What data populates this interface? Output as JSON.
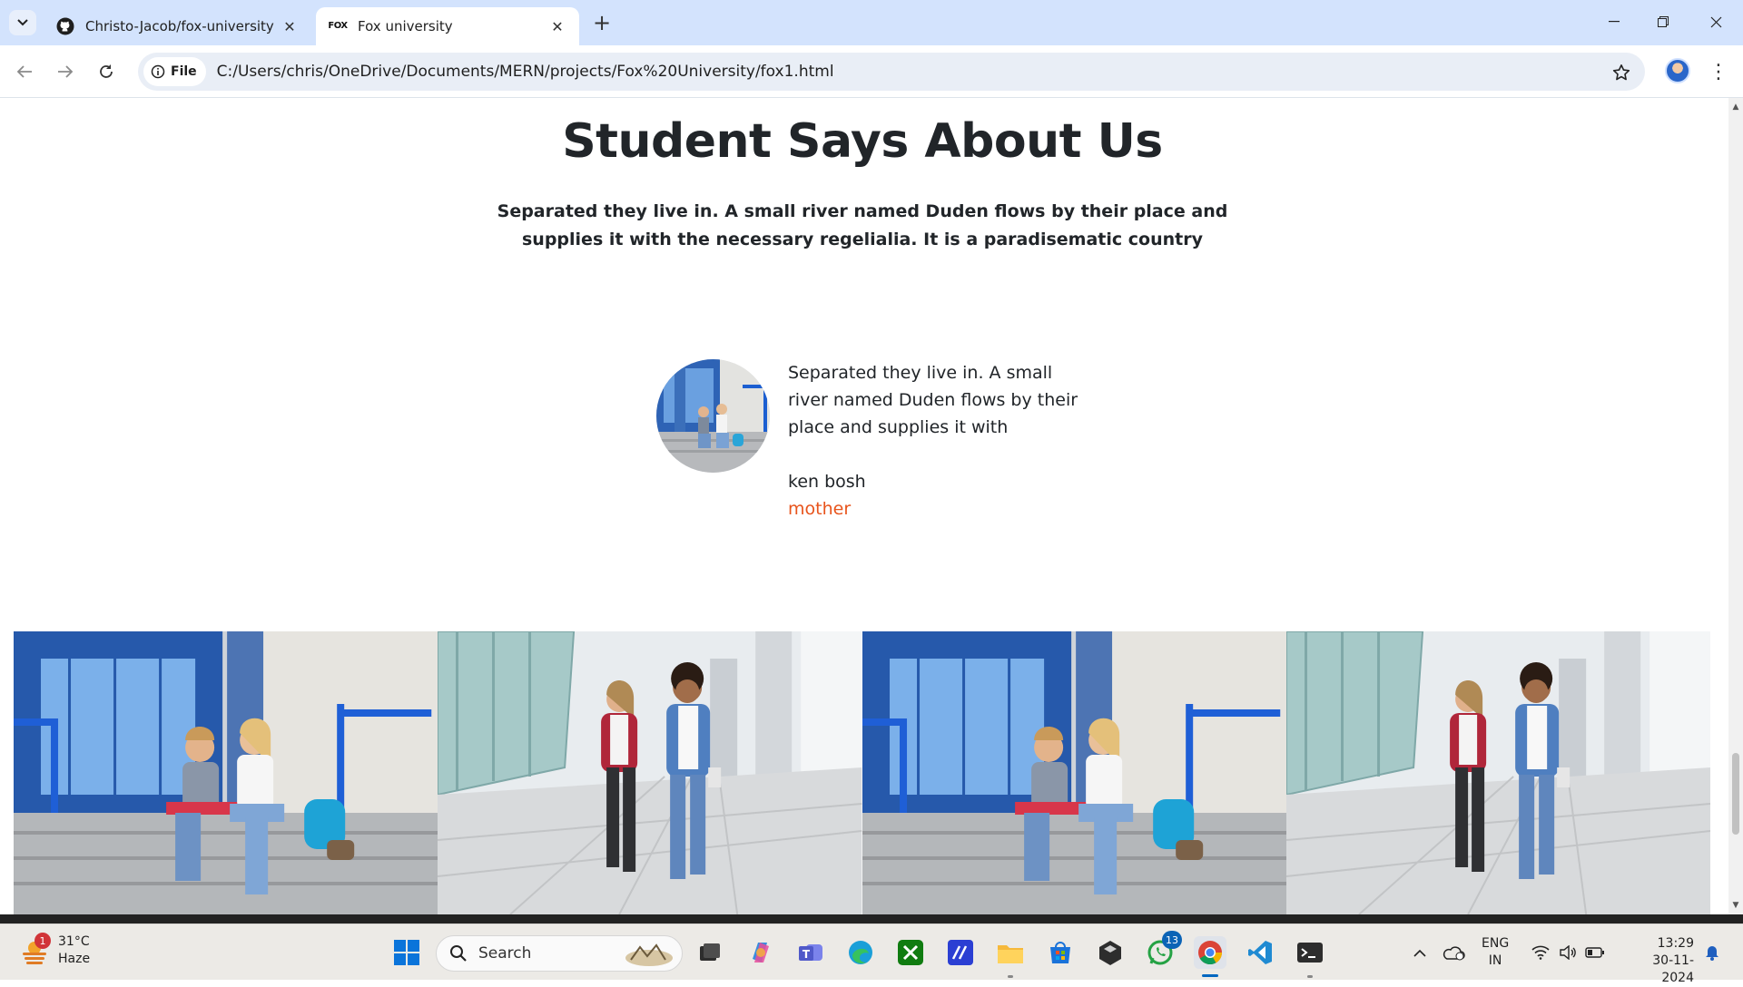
{
  "browser": {
    "tabs": [
      {
        "title": "Christo-Jacob/fox-university",
        "active": false,
        "favicon": "github-icon"
      },
      {
        "title": "Fox university",
        "active": true,
        "favicon": "fox-logo-icon"
      }
    ],
    "favicon_text": "FOX",
    "address": {
      "chip_label": "File",
      "url": "C:/Users/chris/OneDrive/Documents/MERN/projects/Fox%20University/fox1.html"
    }
  },
  "page": {
    "heading": "Student Says About Us",
    "subheading": "Separated they live in. A small river named Duden flows by their place and supplies it with the necessary regelialia. It is a paradisematic country",
    "testimonial": {
      "text": "Separated they live in. A small river named Duden flows by their place and supplies it with",
      "name": "ken bosh",
      "role": "mother",
      "role_color": "#e8541c"
    },
    "gallery": [
      "students-sitting-on-steps",
      "students-walking",
      "students-sitting-on-steps",
      "students-walking"
    ]
  },
  "taskbar": {
    "weather": {
      "temp": "31°C",
      "condition": "Haze",
      "badge": "1"
    },
    "search_placeholder": "Search",
    "whatsapp_badge": "13",
    "language": {
      "line1": "ENG",
      "line2": "IN"
    },
    "clock": {
      "time": "13:29",
      "date": "30-11-2024"
    }
  },
  "colors": {
    "tabbar": "#d3e3fd",
    "accent": "#0067c0",
    "orange": "#e8541c"
  }
}
